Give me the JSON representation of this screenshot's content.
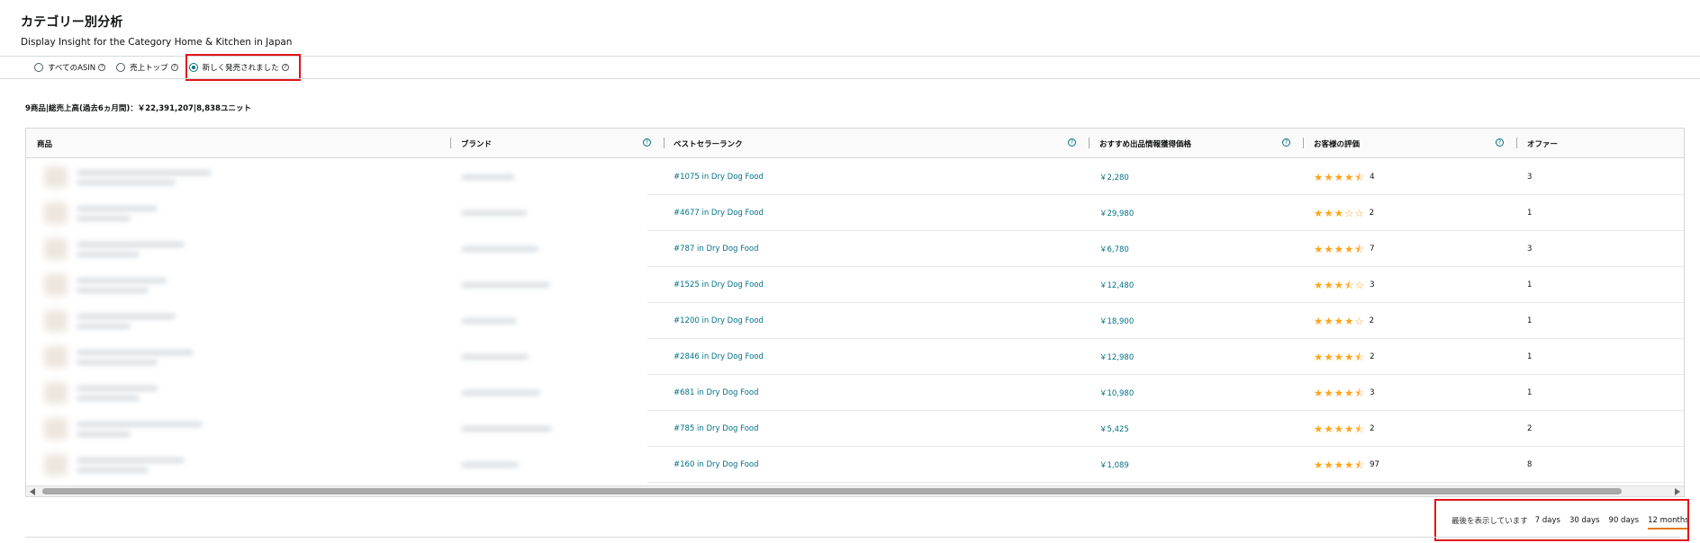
{
  "header": {
    "title": "カテゴリー別分析",
    "subtitle": "Display Insight for the Category Home & Kitchen in Japan"
  },
  "filter": {
    "options": [
      {
        "label": "すべてのASIN",
        "selected": false
      },
      {
        "label": "売上トップ",
        "selected": false
      },
      {
        "label": "新しく発売されました",
        "selected": true
      }
    ]
  },
  "summary": "9商品|総売上高(過去6ヵ月間)：￥22,391,207|8,838ユニット",
  "table": {
    "columns": [
      "商品",
      "ブランド",
      "ベストセラーランク",
      "おすすめ出品情報獲得価格",
      "お客様の評価",
      "オファー"
    ],
    "rows": [
      {
        "rank": "#1075 in Dry Dog Food",
        "price": "￥2,280",
        "rating": 4.5,
        "reviews": "4",
        "offers": "3"
      },
      {
        "rank": "#4677 in Dry Dog Food",
        "price": "￥29,980",
        "rating": 3,
        "reviews": "2",
        "offers": "1"
      },
      {
        "rank": "#787 in Dry Dog Food",
        "price": "￥6,780",
        "rating": 4.5,
        "reviews": "7",
        "offers": "3"
      },
      {
        "rank": "#1525 in Dry Dog Food",
        "price": "￥12,480",
        "rating": 3.5,
        "reviews": "3",
        "offers": "1"
      },
      {
        "rank": "#1200 in Dry Dog Food",
        "price": "￥18,900",
        "rating": 4,
        "reviews": "2",
        "offers": "1"
      },
      {
        "rank": "#2846 in Dry Dog Food",
        "price": "￥12,980",
        "rating": 4.5,
        "reviews": "2",
        "offers": "1"
      },
      {
        "rank": "#681 in Dry Dog Food",
        "price": "￥10,980",
        "rating": 4.5,
        "reviews": "3",
        "offers": "1"
      },
      {
        "rank": "#785 in Dry Dog Food",
        "price": "￥5,425",
        "rating": 4.5,
        "reviews": "2",
        "offers": "2"
      },
      {
        "rank": "#160 in Dry Dog Food",
        "price": "￥1,089",
        "rating": 4.5,
        "reviews": "97",
        "offers": "8"
      }
    ]
  },
  "range": {
    "label": "最後を表示しています",
    "options": [
      {
        "label": "7 days",
        "selected": false
      },
      {
        "label": "30 days",
        "selected": false
      },
      {
        "label": "90 days",
        "selected": false
      },
      {
        "label": "12 months",
        "selected": true
      }
    ]
  },
  "colors": {
    "accent": "#007185",
    "star": "#ffa41c",
    "highlight": "#e3141b",
    "selected_underline": "#e47911"
  }
}
